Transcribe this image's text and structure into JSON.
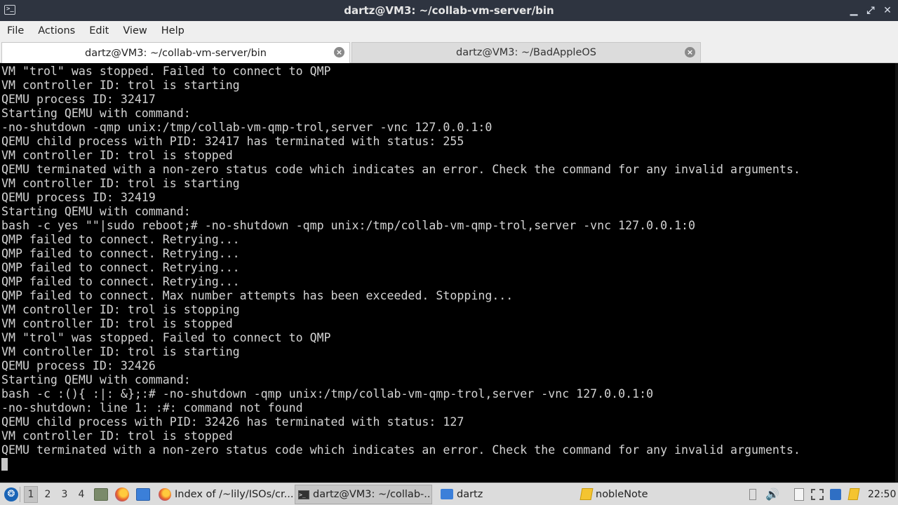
{
  "window": {
    "title": "dartz@VM3: ~/collab-vm-server/bin",
    "controls": {
      "minimize": "▁",
      "maximize": "⤢",
      "close": "✕"
    }
  },
  "menu": [
    "File",
    "Actions",
    "Edit",
    "View",
    "Help"
  ],
  "tabs": [
    {
      "label": "dartz@VM3: ~/collab-vm-server/bin",
      "active": true
    },
    {
      "label": "dartz@VM3: ~/BadAppleOS",
      "active": false
    }
  ],
  "terminal": {
    "lines": [
      "VM \"trol\" was stopped. Failed to connect to QMP",
      "VM controller ID: trol is starting",
      "QEMU process ID: 32417",
      "Starting QEMU with command:",
      "-no-shutdown -qmp unix:/tmp/collab-vm-qmp-trol,server -vnc 127.0.0.1:0",
      "QEMU child process with PID: 32417 has terminated with status: 255",
      "VM controller ID: trol is stopped",
      "QEMU terminated with a non-zero status code which indicates an error. Check the command for any invalid arguments.",
      "VM controller ID: trol is starting",
      "QEMU process ID: 32419",
      "Starting QEMU with command:",
      "bash -c yes \"\"|sudo reboot;# -no-shutdown -qmp unix:/tmp/collab-vm-qmp-trol,server -vnc 127.0.0.1:0",
      "QMP failed to connect. Retrying...",
      "QMP failed to connect. Retrying...",
      "QMP failed to connect. Retrying...",
      "QMP failed to connect. Retrying...",
      "QMP failed to connect. Max number attempts has been exceeded. Stopping...",
      "VM controller ID: trol is stopping",
      "VM controller ID: trol is stopped",
      "VM \"trol\" was stopped. Failed to connect to QMP",
      "VM controller ID: trol is starting",
      "QEMU process ID: 32426",
      "Starting QEMU with command:",
      "bash -c :(){ :|: &};:# -no-shutdown -qmp unix:/tmp/collab-vm-qmp-trol,server -vnc 127.0.0.1:0",
      "-no-shutdown: line 1: :#: command not found",
      "QEMU child process with PID: 32426 has terminated with status: 127",
      "VM controller ID: trol is stopped",
      "QEMU terminated with a non-zero status code which indicates an error. Check the command for any invalid arguments."
    ]
  },
  "taskbar": {
    "workspaces": [
      "1",
      "2",
      "3",
      "4"
    ],
    "active_workspace": "1",
    "tasks": [
      {
        "label": "Index of /~lily/ISOs/cr...",
        "icon": "firefox-icon"
      },
      {
        "label": "dartz@VM3: ~/collab-...",
        "icon": "terminal-icon"
      },
      {
        "label": "dartz",
        "icon": "folder-icon"
      },
      {
        "label": "nobleNote",
        "icon": "note-icon"
      }
    ],
    "clock": "22:50"
  },
  "colors": {
    "terminal_bg": "#000000",
    "terminal_fg": "#d3d3d3",
    "title_bg": "#2e3440",
    "start_blue": "#1a64b6",
    "firefox_orange": "#e8652c",
    "folder_blue": "#3b7fd9",
    "note_yellow": "#f4c430"
  }
}
